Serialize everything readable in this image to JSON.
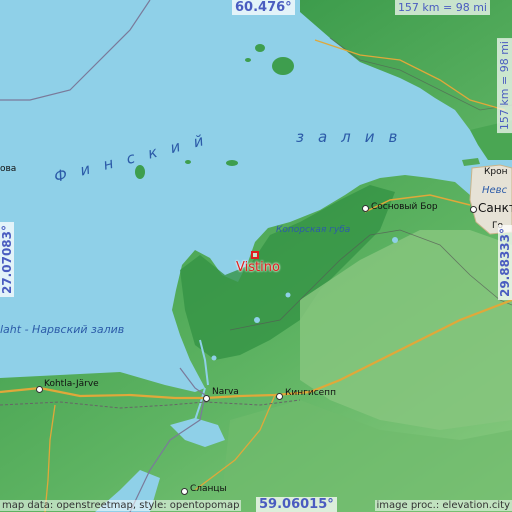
{
  "coordinates": {
    "north": "60.476°",
    "south": "59.06015°",
    "west": "27.07083°",
    "east": "29.88333°"
  },
  "scale": {
    "horizontal": "157 km = 98 mi",
    "vertical": "157 km = 98 mi"
  },
  "water_labels": {
    "gulf_left": "Финский",
    "gulf_right": "залив",
    "koporskaya_bay": "Копорская губа",
    "narva_bay": "laht - Нарвский залив",
    "neva": "Невс"
  },
  "places": {
    "main_city": "Vistino",
    "sosnovy_bor": "Сосновый Бор",
    "sankt": "Санкт",
    "kron": "Крон",
    "kohtla": "Kohtla-Järve",
    "narva": "Narva",
    "kingisepp": "Кингисепп",
    "slantsy": "Сланцы",
    "ova": "ова",
    "go": "Го"
  },
  "attribution": {
    "left": "map data: openstreetmap, style: opentopomap",
    "right": "image proc.: elevation.city"
  },
  "colors": {
    "water": "#8fd0e8",
    "lowland": "#3e9e4e",
    "upland": "#7cc07a",
    "marker": "#e02020",
    "coord_text": "#4a5cc0"
  }
}
